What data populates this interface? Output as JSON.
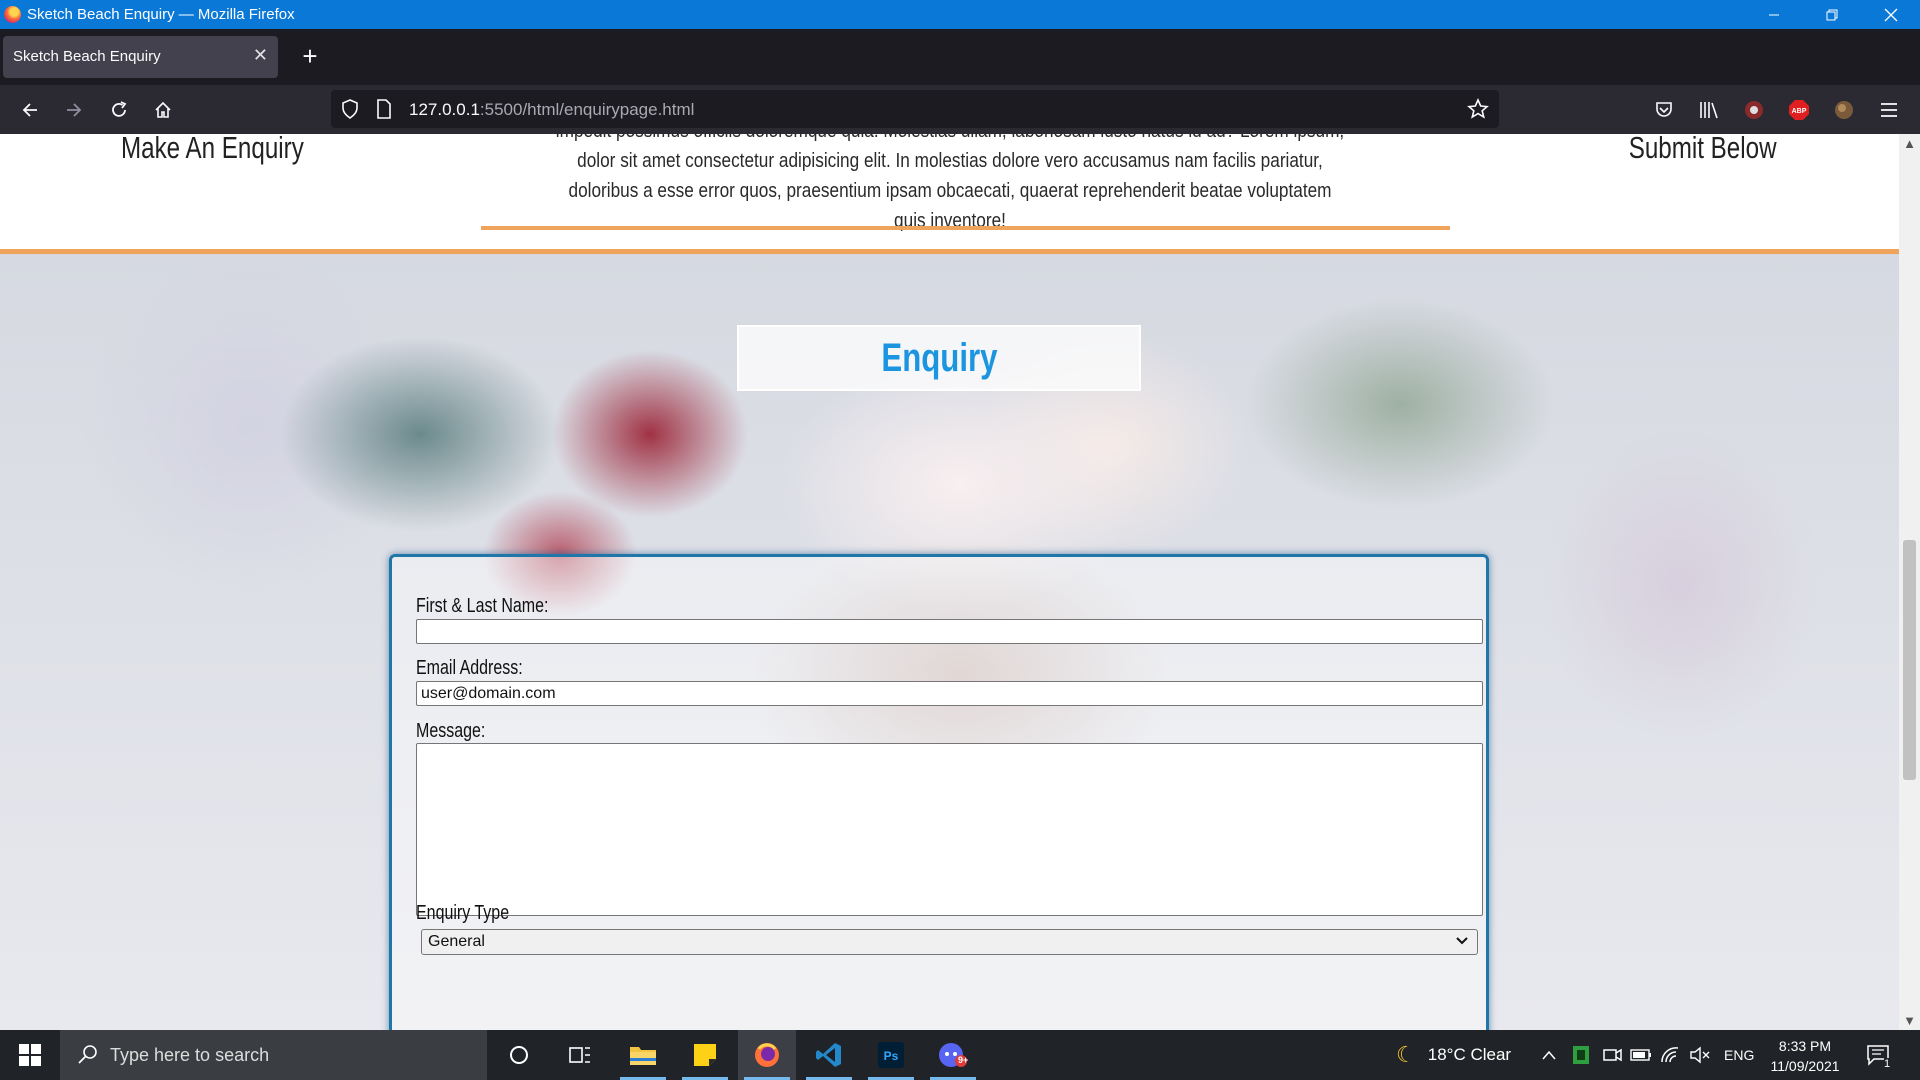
{
  "window": {
    "title": "Sketch Beach Enquiry — Mozilla Firefox",
    "controls": {
      "minimize": "—",
      "restore": "❐",
      "close": "✕"
    }
  },
  "tabs": [
    {
      "label": "Sketch Beach Enquiry",
      "close": "✕"
    }
  ],
  "new_tab": "+",
  "address_bar": {
    "host": "127.0.0.1",
    "rest": ":5500/html/enquirypage.html"
  },
  "page": {
    "header": {
      "left": "Make An Enquiry",
      "right": "Submit Below",
      "text": "impedit possimus officiis doloremque quia. Molestias ullam, laboriosam iusto natus id ad? Lorem ipsum, dolor sit amet consectetur adipisicing elit. In molestias dolore vero accusamus nam facilis pariatur, doloribus a esse error quos, praesentium ipsam obcaecati, quaerat reprehenderit beatae voluptatem quis inventore!"
    },
    "hero_title": "Enquiry",
    "form": {
      "name_label": "First & Last Name:",
      "name_value": "",
      "email_label": "Email Address:",
      "email_value": "user@domain.com",
      "message_label": "Message:",
      "enquiry_type_label": "Enquiry Type",
      "enquiry_type_value": "General"
    }
  },
  "taskbar": {
    "search_placeholder": "Type here to search",
    "weather": "18°C  Clear",
    "language": "ENG",
    "time": "8:33 PM",
    "date": "11/09/2021",
    "notification_count": "1",
    "discord_badge": "9+"
  },
  "colors": {
    "titlebar": "#0a78d7",
    "accent_orange": "#f0a35a",
    "enquiry_blue": "#1b95e0",
    "form_border": "#1f76a8"
  }
}
